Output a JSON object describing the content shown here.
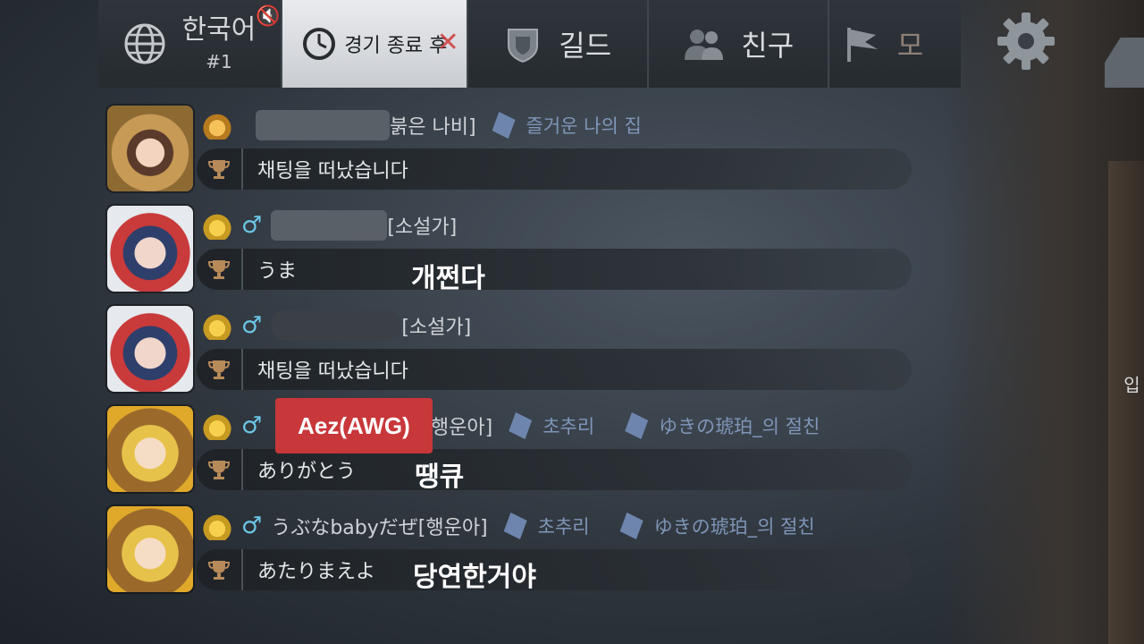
{
  "tabs": {
    "language": {
      "name": "한국어",
      "count": "#1"
    },
    "after_match": "경기 종료 후",
    "guild": "길드",
    "friends": "친구",
    "more": "모"
  },
  "edge_label": "입",
  "messages": [
    {
      "name_suffix": "붉은 나비]",
      "tags": [
        "즐거운 나의 집"
      ],
      "text": "채팅을 떠났습니다",
      "overlay": ""
    },
    {
      "name_suffix": "[소설가]",
      "tags": [],
      "text": "うま",
      "overlay": "개쩐다"
    },
    {
      "name_suffix": "[소설가]",
      "tags": [],
      "text": "채팅을 떠났습니다",
      "overlay": ""
    },
    {
      "name_suffix": "[행운아]",
      "tags": [
        "초추리",
        "ゆきの琥珀_의 절친"
      ],
      "text": "ありがとう",
      "overlay": "땡큐"
    },
    {
      "name": "うぶなbabyだぜ",
      "name_suffix": "[행운아]",
      "tags": [
        "초추리",
        "ゆきの琥珀_의 절친"
      ],
      "text": "あたりまえよ",
      "overlay": "당연한거야"
    }
  ],
  "red_label": "Aez(AWG)",
  "colors": {
    "male": "#6cc6e6",
    "tag": "#7f95b8",
    "label_red": "#c8373a"
  }
}
